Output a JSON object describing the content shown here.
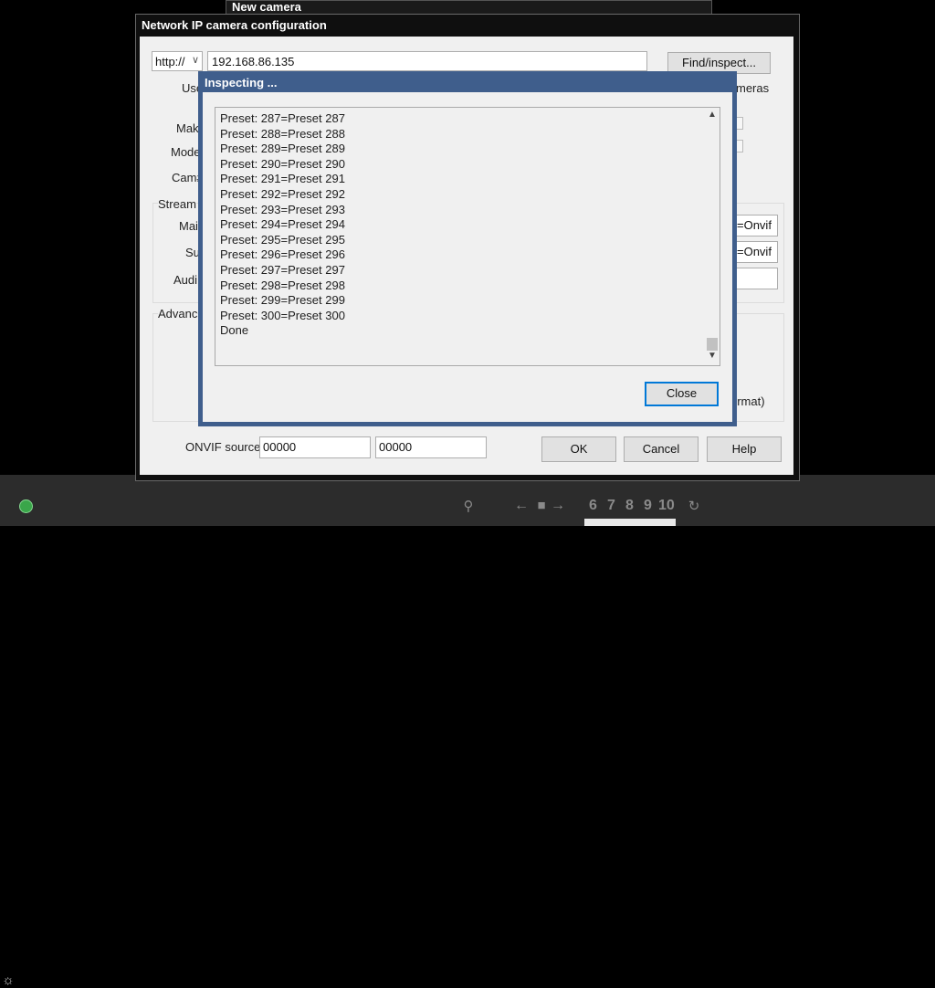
{
  "background_window": {
    "title": "New camera"
  },
  "dialog": {
    "title": "Network IP camera configuration",
    "protocol": {
      "value": "http://"
    },
    "address": {
      "value": "192.168.86.135"
    },
    "find_inspect_label": "Find/inspect...",
    "labels": {
      "user": "Use",
      "make": "Mak",
      "model": "Mode",
      "cam": "Cam#",
      "stream": "Stream",
      "main": "Mai",
      "sub": "Su",
      "audio": "Audi",
      "advanced": "Advanc",
      "cameras_frag": "meras",
      "format_frag": "ormat)",
      "onvif_source": "ONVIF source:"
    },
    "main_stream_value": "=Onvif",
    "sub_stream_value": "=Onvif",
    "onvif_source_1": "00000",
    "onvif_source_2": "00000",
    "buttons": {
      "ok": "OK",
      "cancel": "Cancel",
      "help": "Help"
    }
  },
  "inspect_dialog": {
    "title": "Inspecting ...",
    "log_lines": [
      "Preset: 287=Preset 287",
      "Preset: 288=Preset 288",
      "Preset: 289=Preset 289",
      "Preset: 290=Preset 290",
      "Preset: 291=Preset 291",
      "Preset: 292=Preset 292",
      "Preset: 293=Preset 293",
      "Preset: 294=Preset 294",
      "Preset: 295=Preset 295",
      "Preset: 296=Preset 296",
      "Preset: 297=Preset 297",
      "Preset: 298=Preset 298",
      "Preset: 299=Preset 299",
      "Preset: 300=Preset 300",
      "Done"
    ],
    "close_label": "Close"
  },
  "bottom_bar": {
    "preset_numbers": [
      "6",
      "7",
      "8",
      "9",
      "10"
    ],
    "icons": [
      "brightness-icon",
      "bulb-icon",
      "arrow-left-icon",
      "stop-icon",
      "arrow-right-icon",
      "refresh-icon"
    ]
  }
}
